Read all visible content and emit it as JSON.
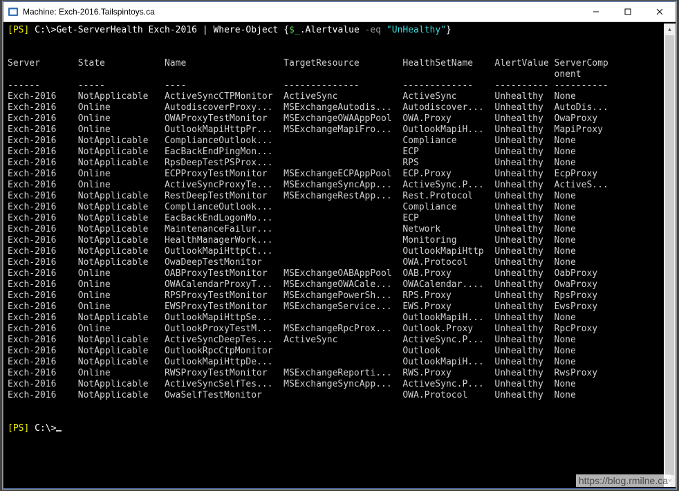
{
  "window": {
    "title": "Machine: Exch-2016.Tailspintoys.ca"
  },
  "prompt": {
    "ps_label": "[PS]",
    "path": " C:\\>",
    "cmd_get": "Get-ServerHealth",
    "arg_server": " Exch-2016",
    "pipe": " | ",
    "cmd_where": "Where-Object",
    "brace_open": " {",
    "var": "$_",
    "prop": ".Alertvalue",
    "op": " -eq ",
    "val": "\"UnHealthy\"",
    "brace_close": "}",
    "final_ps": "[PS]",
    "final_path": " C:\\>"
  },
  "columns": {
    "server": "Server",
    "state": "State",
    "name": "Name",
    "target": "TargetResource",
    "healthset": "HealthSetName",
    "alert": "AlertValue",
    "comp1": "ServerComp",
    "comp2": "onent"
  },
  "underlines": {
    "server": "------",
    "state": "-----",
    "name": "----",
    "target": "--------------",
    "healthset": "-------------",
    "alert": "----------",
    "comp": "----------"
  },
  "rows": [
    {
      "server": "Exch-2016",
      "state": "NotApplicable",
      "name": "ActiveSyncCTPMonitor",
      "target": "ActiveSync",
      "healthset": "ActiveSync",
      "alert": "Unhealthy",
      "comp": "None"
    },
    {
      "server": "Exch-2016",
      "state": "Online",
      "name": "AutodiscoverProxy...",
      "target": "MSExchangeAutodis...",
      "healthset": "Autodiscover...",
      "alert": "Unhealthy",
      "comp": "AutoDis..."
    },
    {
      "server": "Exch-2016",
      "state": "Online",
      "name": "OWAProxyTestMonitor",
      "target": "MSExchangeOWAAppPool",
      "healthset": "OWA.Proxy",
      "alert": "Unhealthy",
      "comp": "OwaProxy"
    },
    {
      "server": "Exch-2016",
      "state": "Online",
      "name": "OutlookMapiHttpPr...",
      "target": "MSExchangeMapiFro...",
      "healthset": "OutlookMapiH...",
      "alert": "Unhealthy",
      "comp": "MapiProxy"
    },
    {
      "server": "Exch-2016",
      "state": "NotApplicable",
      "name": "ComplianceOutlook...",
      "target": "",
      "healthset": "Compliance",
      "alert": "Unhealthy",
      "comp": "None"
    },
    {
      "server": "Exch-2016",
      "state": "NotApplicable",
      "name": "EacBackEndPingMon...",
      "target": "",
      "healthset": "ECP",
      "alert": "Unhealthy",
      "comp": "None"
    },
    {
      "server": "Exch-2016",
      "state": "NotApplicable",
      "name": "RpsDeepTestPSProx...",
      "target": "",
      "healthset": "RPS",
      "alert": "Unhealthy",
      "comp": "None"
    },
    {
      "server": "Exch-2016",
      "state": "Online",
      "name": "ECPProxyTestMonitor",
      "target": "MSExchangeECPAppPool",
      "healthset": "ECP.Proxy",
      "alert": "Unhealthy",
      "comp": "EcpProxy"
    },
    {
      "server": "Exch-2016",
      "state": "Online",
      "name": "ActiveSyncProxyTe...",
      "target": "MSExchangeSyncApp...",
      "healthset": "ActiveSync.P...",
      "alert": "Unhealthy",
      "comp": "ActiveS..."
    },
    {
      "server": "Exch-2016",
      "state": "NotApplicable",
      "name": "RestDeepTestMonitor",
      "target": "MSExchangeRestApp...",
      "healthset": "Rest.Protocol",
      "alert": "Unhealthy",
      "comp": "None"
    },
    {
      "server": "Exch-2016",
      "state": "NotApplicable",
      "name": "ComplianceOutlook...",
      "target": "",
      "healthset": "Compliance",
      "alert": "Unhealthy",
      "comp": "None"
    },
    {
      "server": "Exch-2016",
      "state": "NotApplicable",
      "name": "EacBackEndLogonMo...",
      "target": "",
      "healthset": "ECP",
      "alert": "Unhealthy",
      "comp": "None"
    },
    {
      "server": "Exch-2016",
      "state": "NotApplicable",
      "name": "MaintenanceFailur...",
      "target": "",
      "healthset": "Network",
      "alert": "Unhealthy",
      "comp": "None"
    },
    {
      "server": "Exch-2016",
      "state": "NotApplicable",
      "name": "HealthManagerWork...",
      "target": "",
      "healthset": "Monitoring",
      "alert": "Unhealthy",
      "comp": "None"
    },
    {
      "server": "Exch-2016",
      "state": "NotApplicable",
      "name": "OutlookMapiHttpCt...",
      "target": "",
      "healthset": "OutlookMapiHttp",
      "alert": "Unhealthy",
      "comp": "None"
    },
    {
      "server": "Exch-2016",
      "state": "NotApplicable",
      "name": "OwaDeepTestMonitor",
      "target": "",
      "healthset": "OWA.Protocol",
      "alert": "Unhealthy",
      "comp": "None"
    },
    {
      "server": "Exch-2016",
      "state": "Online",
      "name": "OABProxyTestMonitor",
      "target": "MSExchangeOABAppPool",
      "healthset": "OAB.Proxy",
      "alert": "Unhealthy",
      "comp": "OabProxy"
    },
    {
      "server": "Exch-2016",
      "state": "Online",
      "name": "OWACalendarProxyT...",
      "target": "MSExchangeOWACale...",
      "healthset": "OWACalendar....",
      "alert": "Unhealthy",
      "comp": "OwaProxy"
    },
    {
      "server": "Exch-2016",
      "state": "Online",
      "name": "RPSProxyTestMonitor",
      "target": "MSExchangePowerSh...",
      "healthset": "RPS.Proxy",
      "alert": "Unhealthy",
      "comp": "RpsProxy"
    },
    {
      "server": "Exch-2016",
      "state": "Online",
      "name": "EWSProxyTestMonitor",
      "target": "MSExchangeService...",
      "healthset": "EWS.Proxy",
      "alert": "Unhealthy",
      "comp": "EwsProxy"
    },
    {
      "server": "Exch-2016",
      "state": "NotApplicable",
      "name": "OutlookMapiHttpSe...",
      "target": "",
      "healthset": "OutlookMapiH...",
      "alert": "Unhealthy",
      "comp": "None"
    },
    {
      "server": "Exch-2016",
      "state": "Online",
      "name": "OutlookProxyTestM...",
      "target": "MSExchangeRpcProx...",
      "healthset": "Outlook.Proxy",
      "alert": "Unhealthy",
      "comp": "RpcProxy"
    },
    {
      "server": "Exch-2016",
      "state": "NotApplicable",
      "name": "ActiveSyncDeepTes...",
      "target": "ActiveSync",
      "healthset": "ActiveSync.P...",
      "alert": "Unhealthy",
      "comp": "None"
    },
    {
      "server": "Exch-2016",
      "state": "NotApplicable",
      "name": "OutlookRpcCtpMonitor",
      "target": "",
      "healthset": "Outlook",
      "alert": "Unhealthy",
      "comp": "None"
    },
    {
      "server": "Exch-2016",
      "state": "NotApplicable",
      "name": "OutlookMapiHttpDe...",
      "target": "",
      "healthset": "OutlookMapiH...",
      "alert": "Unhealthy",
      "comp": "None"
    },
    {
      "server": "Exch-2016",
      "state": "Online",
      "name": "RWSProxyTestMonitor",
      "target": "MSExchangeReporti...",
      "healthset": "RWS.Proxy",
      "alert": "Unhealthy",
      "comp": "RwsProxy"
    },
    {
      "server": "Exch-2016",
      "state": "NotApplicable",
      "name": "ActiveSyncSelfTes...",
      "target": "MSExchangeSyncApp...",
      "healthset": "ActiveSync.P...",
      "alert": "Unhealthy",
      "comp": "None"
    },
    {
      "server": "Exch-2016",
      "state": "NotApplicable",
      "name": "OwaSelfTestMonitor",
      "target": "",
      "healthset": "OWA.Protocol",
      "alert": "Unhealthy",
      "comp": "None"
    }
  ],
  "watermark": "https://blog.rmilne.ca"
}
